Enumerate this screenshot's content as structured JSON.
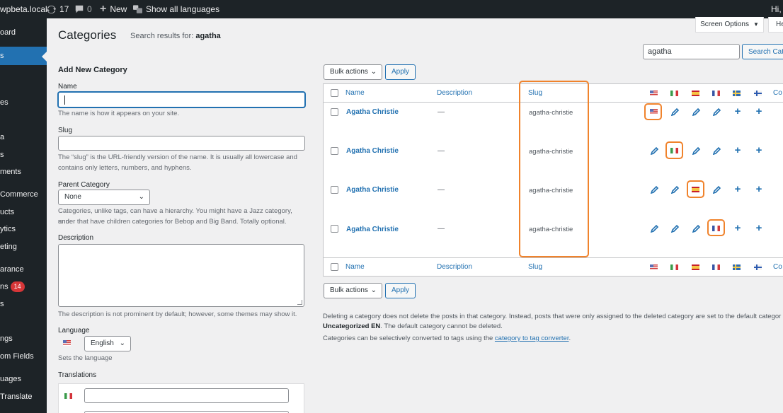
{
  "admin_bar": {
    "site_name": "wpbeta.local",
    "updates_count": "17",
    "comments_count": "0",
    "new_label": "New",
    "languages_label": "Show all languages",
    "greeting": "Hi, n"
  },
  "sidebar": {
    "items": [
      {
        "label": "oard"
      },
      {
        "label": "s"
      },
      {
        "label": "es"
      },
      {
        "label": "a"
      },
      {
        "label": "s"
      },
      {
        "label": "ments"
      },
      {
        "label": "Commerce"
      },
      {
        "label": "ucts"
      },
      {
        "label": "ytics"
      },
      {
        "label": "eting"
      },
      {
        "label": "arance"
      },
      {
        "label": "ns",
        "badge": "14"
      },
      {
        "label": "s"
      },
      {
        "label": "ngs"
      },
      {
        "label": "om Fields"
      },
      {
        "label": "uages"
      },
      {
        "label": "Translate"
      }
    ]
  },
  "header": {
    "title": "Categories",
    "search_results_prefix": "Search results for:",
    "search_term": "agatha",
    "screen_options_label": "Screen Options",
    "help_label": "He"
  },
  "search": {
    "value": "agatha",
    "button_label": "Search Cate"
  },
  "form": {
    "heading": "Add New Category",
    "name_label": "Name",
    "name_help": "The name is how it appears on your site.",
    "slug_label": "Slug",
    "slug_help_1": "The “slug” is the URL-friendly version of the name. It is usually all lowercase and",
    "slug_help_2": "contains only letters, numbers, and hyphens.",
    "parent_label": "Parent Category",
    "parent_value": "None",
    "parent_help_1": "Categories, unlike tags, can have a hierarchy. You might have a Jazz category, and",
    "parent_help_2": "under that have children categories for Bebop and Big Band. Totally optional.",
    "description_label": "Description",
    "description_help": "The description is not prominent by default; however, some themes may show it.",
    "language_label": "Language",
    "language_value": "English",
    "language_help": "Sets the language",
    "translations_label": "Translations"
  },
  "table": {
    "bulk_actions_label": "Bulk actions",
    "apply_label": "Apply",
    "columns": {
      "name": "Name",
      "description": "Description",
      "slug": "Slug",
      "count_partial": "Co"
    },
    "rows": [
      {
        "name": "Agatha Christie",
        "description": "—",
        "slug": "agatha-christie"
      },
      {
        "name": "Agatha Christie",
        "description": "—",
        "slug": "agatha-christie"
      },
      {
        "name": "Agatha Christie",
        "description": "—",
        "slug": "agatha-christie"
      },
      {
        "name": "Agatha Christie",
        "description": "—",
        "slug": "agatha-christie"
      }
    ],
    "languages": [
      "us",
      "it",
      "es",
      "fr",
      "se",
      "fi"
    ]
  },
  "notes": {
    "line1": "Deleting a category does not delete the posts in that category. Instead, posts that were only assigned to the deleted category are set to the default categor",
    "line2_bold": "Uncategorized EN",
    "line2_rest": ". The default category cannot be deleted.",
    "line3_prefix": "Categories can be selectively converted to tags using the ",
    "line3_link": "category to tag converter",
    "line3_suffix": "."
  },
  "colors": {
    "link": "#2271b1",
    "highlight": "#f0832c",
    "admin_dark": "#1d2327"
  }
}
